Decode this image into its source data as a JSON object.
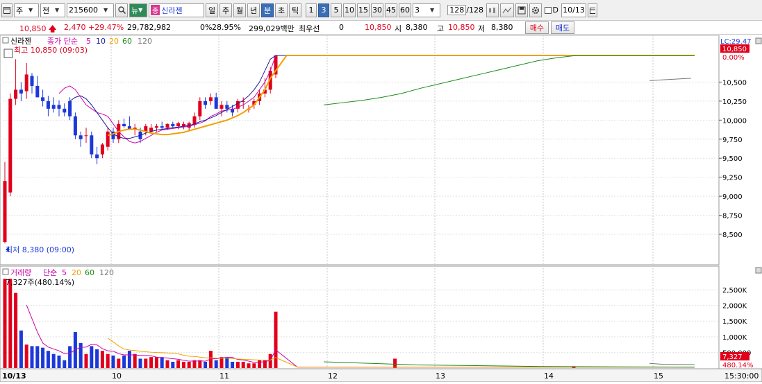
{
  "toolbar": {
    "type_label": "주",
    "period_label": "전",
    "code": "215600",
    "news_label": "뉴",
    "stock_tag": "종",
    "stock_name": "신라젠",
    "periods": [
      "일",
      "주",
      "월",
      "년",
      "분",
      "초",
      "틱"
    ],
    "active_period": "분",
    "intervals": [
      "1",
      "3",
      "5",
      "10",
      "15",
      "30",
      "45",
      "60"
    ],
    "active_interval": "3",
    "interval_value": "3",
    "count": "128",
    "count_total": "/128",
    "date_checkbox_label": "D",
    "date_value": "10/13"
  },
  "info": {
    "price": "10,850",
    "change": "2,470",
    "change_pct": "+29.47%",
    "volume": "29,782,982",
    "zero_pct": "0%",
    "turnover_pct": "28.95%",
    "amount": "299,029백만",
    "best_priority": "최우선",
    "best_value": "0",
    "best_price": "10,850",
    "open_label": "시",
    "open": "8,380",
    "high_label": "고",
    "high": "10,850",
    "low_label": "저",
    "low": "8,380",
    "buy_label": "매수",
    "sell_label": "매도"
  },
  "price_panel": {
    "title": "신라젠",
    "ma_label": "종가 단순",
    "ma_periods": [
      "5",
      "10",
      "20",
      "60",
      "120"
    ],
    "high_note": "최고 10,850 (09:03)",
    "low_note": "최저 8,380 (09:00)",
    "lc_label": "LC:29.47",
    "current_tag": "10,850",
    "pct_label": "0.00%"
  },
  "volume_panel": {
    "title": "거래량",
    "ma_label": "단순",
    "ma_periods": [
      "5",
      "20",
      "60",
      "120"
    ],
    "volume_note": "7,327주(480.14%)",
    "current_tag": "7,327",
    "pct_tag": "480.14%"
  },
  "time_axis": {
    "labels": [
      "10/13",
      "10",
      "11",
      "12",
      "13",
      "14",
      "15"
    ],
    "end_time": "15:30:00"
  },
  "colors": {
    "up": "#e0001b",
    "down": "#1c38d8",
    "ma5": "#cc00aa",
    "ma10": "#1a1a9a",
    "ma20": "#f0a000",
    "ma60": "#1a8a1a",
    "ma120": "#777777"
  },
  "chart_data": {
    "type": "candlestick",
    "price_axis": [
      "10,500",
      "10,250",
      "10,000",
      "9,750",
      "9,500",
      "9,250",
      "9,000",
      "8,750",
      "8,500"
    ],
    "price_range": [
      8300,
      10950
    ],
    "volume_axis": [
      "2,500K",
      "2,000K",
      "1,500K",
      "1,000K",
      "500,000"
    ],
    "volume_range": [
      0,
      2900
    ],
    "candles": [
      {
        "o": 8400,
        "h": 9450,
        "l": 8380,
        "c": 9200
      },
      {
        "o": 9050,
        "h": 10350,
        "l": 9000,
        "c": 10280
      },
      {
        "o": 10280,
        "h": 10800,
        "l": 10200,
        "c": 10400
      },
      {
        "o": 10400,
        "h": 10500,
        "l": 10250,
        "c": 10350
      },
      {
        "o": 10380,
        "h": 10750,
        "l": 10280,
        "c": 10600
      },
      {
        "o": 10580,
        "h": 10620,
        "l": 10350,
        "c": 10450
      },
      {
        "o": 10450,
        "h": 10580,
        "l": 10300,
        "c": 10300
      },
      {
        "o": 10300,
        "h": 10400,
        "l": 10180,
        "c": 10250
      },
      {
        "o": 10250,
        "h": 10320,
        "l": 10050,
        "c": 10150
      },
      {
        "o": 10200,
        "h": 10300,
        "l": 10100,
        "c": 10150
      },
      {
        "o": 10200,
        "h": 10260,
        "l": 10050,
        "c": 10150
      },
      {
        "o": 10150,
        "h": 10220,
        "l": 10050,
        "c": 10100
      },
      {
        "o": 10250,
        "h": 10300,
        "l": 10000,
        "c": 10050
      },
      {
        "o": 10050,
        "h": 10100,
        "l": 9750,
        "c": 9800
      },
      {
        "o": 9800,
        "h": 9850,
        "l": 9650,
        "c": 9750
      },
      {
        "o": 9800,
        "h": 9900,
        "l": 9700,
        "c": 9800
      },
      {
        "o": 9800,
        "h": 9850,
        "l": 9500,
        "c": 9550
      },
      {
        "o": 9550,
        "h": 9650,
        "l": 9420,
        "c": 9500
      },
      {
        "o": 9550,
        "h": 9700,
        "l": 9500,
        "c": 9680
      },
      {
        "o": 9650,
        "h": 9900,
        "l": 9600,
        "c": 9850
      },
      {
        "o": 9850,
        "h": 9900,
        "l": 9700,
        "c": 9750
      },
      {
        "o": 9750,
        "h": 10000,
        "l": 9700,
        "c": 9950
      },
      {
        "o": 9950,
        "h": 10020,
        "l": 9900,
        "c": 9920
      },
      {
        "o": 9920,
        "h": 10050,
        "l": 9880,
        "c": 9880
      },
      {
        "o": 9880,
        "h": 9950,
        "l": 9800,
        "c": 9900
      },
      {
        "o": 9850,
        "h": 9900,
        "l": 9700,
        "c": 9750
      },
      {
        "o": 9850,
        "h": 9950,
        "l": 9800,
        "c": 9920
      },
      {
        "o": 9850,
        "h": 9950,
        "l": 9820,
        "c": 9900
      },
      {
        "o": 9900,
        "h": 9950,
        "l": 9850,
        "c": 9920
      },
      {
        "o": 9920,
        "h": 9980,
        "l": 9880,
        "c": 9900
      },
      {
        "o": 9900,
        "h": 9960,
        "l": 9870,
        "c": 9950
      },
      {
        "o": 9950,
        "h": 9980,
        "l": 9900,
        "c": 9920
      },
      {
        "o": 9920,
        "h": 9980,
        "l": 9880,
        "c": 9960
      },
      {
        "o": 9920,
        "h": 9980,
        "l": 9880,
        "c": 9950
      },
      {
        "o": 9900,
        "h": 9980,
        "l": 9860,
        "c": 9960
      },
      {
        "o": 9940,
        "h": 10100,
        "l": 9900,
        "c": 10050
      },
      {
        "o": 10050,
        "h": 10300,
        "l": 10000,
        "c": 10250
      },
      {
        "o": 10250,
        "h": 10300,
        "l": 10150,
        "c": 10200
      },
      {
        "o": 10250,
        "h": 10350,
        "l": 10200,
        "c": 10300
      },
      {
        "o": 10300,
        "h": 10360,
        "l": 10150,
        "c": 10150
      },
      {
        "o": 10150,
        "h": 10250,
        "l": 10050,
        "c": 10200
      },
      {
        "o": 10200,
        "h": 10250,
        "l": 10100,
        "c": 10150
      },
      {
        "o": 10150,
        "h": 10200,
        "l": 10050,
        "c": 10100
      },
      {
        "o": 10150,
        "h": 10280,
        "l": 10100,
        "c": 10250
      },
      {
        "o": 10250,
        "h": 10300,
        "l": 10150,
        "c": 10250
      },
      {
        "o": 10150,
        "h": 10200,
        "l": 10100,
        "c": 10150
      },
      {
        "o": 10200,
        "h": 10280,
        "l": 10150,
        "c": 10250
      },
      {
        "o": 10250,
        "h": 10400,
        "l": 10200,
        "c": 10350
      },
      {
        "o": 10350,
        "h": 10550,
        "l": 10300,
        "c": 10400
      },
      {
        "o": 10400,
        "h": 10700,
        "l": 10350,
        "c": 10650
      },
      {
        "o": 10600,
        "h": 10850,
        "l": 10550,
        "c": 10850
      }
    ],
    "volumes": [
      2850,
      2850,
      2400,
      1200,
      750,
      700,
      700,
      650,
      550,
      450,
      400,
      250,
      700,
      1150,
      800,
      450,
      700,
      600,
      550,
      450,
      400,
      300,
      400,
      550,
      450,
      300,
      300,
      350,
      350,
      350,
      250,
      200,
      250,
      200,
      200,
      250,
      250,
      200,
      550,
      250,
      350,
      350,
      200,
      200,
      200,
      150,
      150,
      250,
      250,
      450,
      1800
    ],
    "extra_volumes": [
      {
        "slot": 72,
        "v": 300
      },
      {
        "slot": 105,
        "v": 60
      }
    ],
    "ma5": [
      10350,
      10420,
      10450,
      10400,
      10300,
      10200,
      10150,
      10100,
      10080,
      10050,
      9950,
      9850,
      9780,
      9720,
      9700,
      9720,
      9760,
      9800,
      9840,
      9870,
      9880,
      9890,
      9900,
      9910,
      9920,
      9940,
      9960,
      9990,
      10050,
      10080,
      10120,
      10130,
      10140,
      10170,
      10200,
      10250,
      10300,
      10400,
      10500,
      10650,
      10850
    ],
    "ma10": [
      10250,
      10300,
      10320,
      10280,
      10200,
      10100,
      10000,
      9900,
      9820,
      9780,
      9760,
      9760,
      9780,
      9800,
      9830,
      9850,
      9870,
      9880,
      9890,
      9900,
      9910,
      9920,
      9930,
      9950,
      9980,
      10000,
      10030,
      10060,
      10100,
      10140,
      10180,
      10220,
      10260,
      10320,
      10400,
      10500,
      10650,
      10800,
      10850
    ],
    "ma20": [
      9800,
      9820,
      9850,
      9870,
      9880,
      9880,
      9870,
      9850,
      9830,
      9820,
      9810,
      9810,
      9820,
      9830,
      9840,
      9860,
      9880,
      9900,
      9920,
      9940,
      9960,
      9980,
      10000,
      10030,
      10060,
      10100,
      10150,
      10200,
      10300,
      10400,
      10550,
      10650,
      10750,
      10850,
      10850
    ],
    "ma60": [
      10200,
      10230,
      10260,
      10300,
      10350,
      10420,
      10480,
      10540,
      10600,
      10660,
      10720,
      10780,
      10820,
      10850,
      10850
    ],
    "ma120": [
      10520,
      10530,
      10540,
      10550
    ]
  }
}
